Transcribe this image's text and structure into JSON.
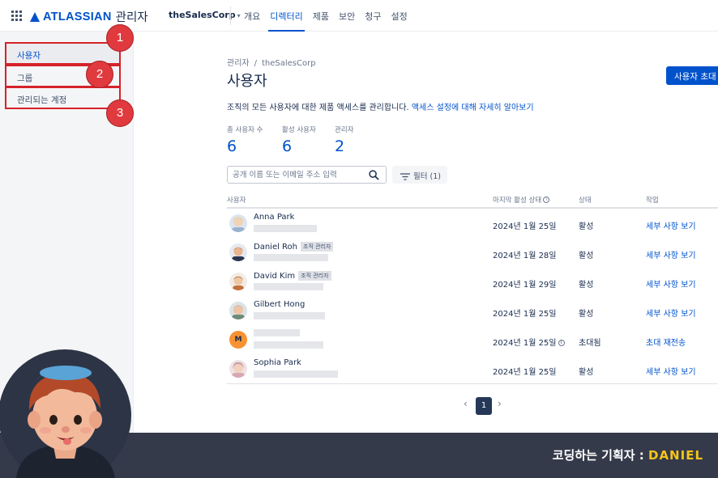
{
  "topbar": {
    "logo_text": "ATLASSIAN",
    "logo_sub": "관리자",
    "org_name": "theSalesCorp",
    "nav": [
      "개요",
      "디렉터리",
      "제품",
      "보안",
      "청구",
      "설정"
    ]
  },
  "sidebar": {
    "items": [
      {
        "label": "사용자",
        "badge": "1"
      },
      {
        "label": "그룹",
        "badge": "2"
      },
      {
        "label": "관리되는 계정",
        "badge": "3"
      }
    ]
  },
  "main": {
    "breadcrumb": [
      "관리자",
      "/",
      "theSalesCorp"
    ],
    "title": "사용자",
    "invite_label": "사용자 초대",
    "description": "조직의 모든 사용자에 대한 제품 액세스를 관리합니다.",
    "description_link": "액세스 설정에 대해 자세히 알아보기",
    "stats": [
      {
        "label": "총 사용자 수",
        "value": "6"
      },
      {
        "label": "활성 사용자",
        "value": "6"
      },
      {
        "label": "관리자",
        "value": "2"
      }
    ],
    "search_placeholder": "공개 이름 또는 이메일 주소 입력",
    "filter_label": "필터 (1)",
    "columns": [
      "사용자",
      "마지막 활성 상태",
      "상태",
      "작업"
    ],
    "rows": [
      {
        "name": "Anna Park",
        "role": "",
        "last_active": "2024년 1월 25일",
        "status": "활성",
        "action": "세부 사항 보기"
      },
      {
        "name": "Daniel Roh",
        "role": "조직 관리자",
        "last_active": "2024년 1월 28일",
        "status": "활성",
        "action": "세부 사항 보기"
      },
      {
        "name": "David Kim",
        "role": "조직 관리자",
        "last_active": "2024년 1월 29일",
        "status": "활성",
        "action": "세부 사항 보기"
      },
      {
        "name": "Gilbert Hong",
        "role": "",
        "last_active": "2024년 1월 25일",
        "status": "활성",
        "action": "세부 사항 보기"
      },
      {
        "name": "",
        "initial": "M",
        "role": "",
        "last_active": "2024년 1월 25일",
        "status": "초대됨",
        "action": "초대 재전송"
      },
      {
        "name": "Sophia Park",
        "role": "",
        "last_active": "2024년 1월 25일",
        "status": "활성",
        "action": "세부 사항 보기"
      }
    ],
    "pagination": {
      "current": "1",
      "prev": "‹",
      "next": "›"
    }
  },
  "footer": {
    "signature_prefix": "코딩하는 기획자 : ",
    "signature_name": "DANIEL"
  },
  "colors": {
    "accent": "#0052cc",
    "annotation": "#d6222a",
    "band": "#353a4a",
    "highlight": "#f5c518"
  }
}
